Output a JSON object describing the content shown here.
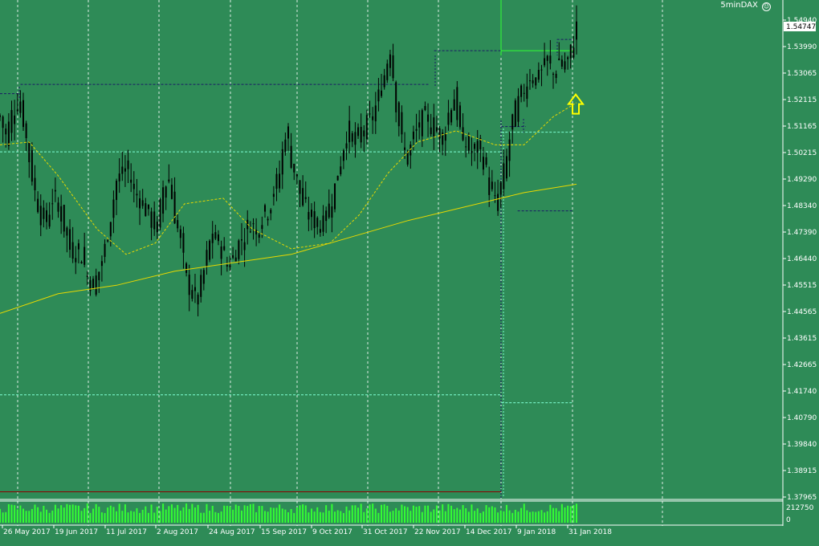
{
  "indicator": {
    "label": "5minDAX",
    "icon": "smiley-icon"
  },
  "chart_data": {
    "type": "candlestick",
    "price_axis": {
      "ticks": [
        "1.54940",
        "1.53990",
        "1.53065",
        "1.52115",
        "1.51165",
        "1.50215",
        "1.49290",
        "1.48340",
        "1.47390",
        "1.46440",
        "1.45515",
        "1.44565",
        "1.43615",
        "1.42665",
        "1.41740",
        "1.40790",
        "1.39840",
        "1.38915",
        "1.37965"
      ],
      "current_price": "1.54747",
      "range": [
        1.37965,
        1.5494
      ]
    },
    "volume_axis": {
      "ticks": [
        "212750",
        "0"
      ]
    },
    "time_axis": {
      "ticks": [
        "26 May 2017",
        "19 Jun 2017",
        "11 Jul 2017",
        "2 Aug 2017",
        "24 Aug 2017",
        "15 Sep 2017",
        "9 Oct 2017",
        "31 Oct 2017",
        "22 Nov 2017",
        "14 Dec 2017",
        "9 Jan 2018",
        "31 Jan 2018"
      ]
    },
    "series": [
      {
        "name": "",
        "kind": "close_path",
        "points": [
          [
            0,
            1.515
          ],
          [
            6,
            1.508
          ],
          [
            12,
            1.516
          ],
          [
            18,
            1.52
          ],
          [
            24,
            1.514
          ],
          [
            30,
            1.5
          ],
          [
            36,
            1.488
          ],
          [
            42,
            1.48
          ],
          [
            48,
            1.478
          ],
          [
            54,
            1.486
          ],
          [
            60,
            1.484
          ],
          [
            66,
            1.476
          ],
          [
            72,
            1.468
          ],
          [
            78,
            1.467
          ],
          [
            84,
            1.466
          ],
          [
            90,
            1.458
          ],
          [
            96,
            1.455
          ],
          [
            102,
            1.46
          ],
          [
            108,
            1.468
          ],
          [
            114,
            1.48
          ],
          [
            120,
            1.492
          ],
          [
            126,
            1.495
          ],
          [
            132,
            1.496
          ],
          [
            138,
            1.488
          ],
          [
            144,
            1.486
          ],
          [
            150,
            1.482
          ],
          [
            156,
            1.478
          ],
          [
            162,
            1.475
          ],
          [
            168,
            1.49
          ],
          [
            174,
            1.493
          ],
          [
            180,
            1.48
          ],
          [
            186,
            1.47
          ],
          [
            192,
            1.457
          ],
          [
            198,
            1.452
          ],
          [
            204,
            1.45
          ],
          [
            210,
            1.46
          ],
          [
            216,
            1.47
          ],
          [
            222,
            1.472
          ],
          [
            228,
            1.468
          ],
          [
            234,
            1.462
          ],
          [
            240,
            1.465
          ],
          [
            246,
            1.47
          ],
          [
            252,
            1.473
          ],
          [
            258,
            1.478
          ],
          [
            264,
            1.474
          ],
          [
            270,
            1.48
          ],
          [
            276,
            1.482
          ],
          [
            282,
            1.488
          ],
          [
            288,
            1.495
          ],
          [
            294,
            1.51
          ],
          [
            300,
            1.5
          ],
          [
            306,
            1.492
          ],
          [
            312,
            1.484
          ],
          [
            318,
            1.48
          ],
          [
            324,
            1.478
          ],
          [
            330,
            1.476
          ],
          [
            336,
            1.48
          ],
          [
            342,
            1.486
          ],
          [
            348,
            1.494
          ],
          [
            354,
            1.505
          ],
          [
            360,
            1.51
          ],
          [
            366,
            1.505
          ],
          [
            372,
            1.51
          ],
          [
            378,
            1.512
          ],
          [
            384,
            1.515
          ],
          [
            390,
            1.522
          ],
          [
            396,
            1.53
          ],
          [
            402,
            1.54
          ],
          [
            408,
            1.52
          ],
          [
            414,
            1.506
          ],
          [
            420,
            1.5
          ],
          [
            426,
            1.508
          ],
          [
            432,
            1.512
          ],
          [
            438,
            1.515
          ],
          [
            444,
            1.512
          ],
          [
            450,
            1.51
          ],
          [
            456,
            1.508
          ],
          [
            462,
            1.516
          ],
          [
            468,
            1.522
          ],
          [
            474,
            1.51
          ],
          [
            480,
            1.505
          ],
          [
            486,
            1.502
          ],
          [
            492,
            1.504
          ],
          [
            498,
            1.5
          ],
          [
            504,
            1.49
          ],
          [
            510,
            1.484
          ],
          [
            516,
            1.49
          ],
          [
            522,
            1.5
          ],
          [
            528,
            1.514
          ],
          [
            534,
            1.52
          ],
          [
            540,
            1.525
          ],
          [
            546,
            1.53
          ],
          [
            552,
            1.528
          ],
          [
            558,
            1.532
          ],
          [
            564,
            1.535
          ],
          [
            570,
            1.53
          ],
          [
            576,
            1.535
          ],
          [
            582,
            1.532
          ],
          [
            588,
            1.538
          ],
          [
            594,
            1.547
          ]
        ],
        "color": "#000000"
      },
      {
        "name": "",
        "kind": "ma_fast",
        "points": [
          [
            0,
            1.505
          ],
          [
            30,
            1.506
          ],
          [
            60,
            1.494
          ],
          [
            100,
            1.475
          ],
          [
            130,
            1.466
          ],
          [
            160,
            1.47
          ],
          [
            190,
            1.484
          ],
          [
            230,
            1.486
          ],
          [
            260,
            1.475
          ],
          [
            300,
            1.468
          ],
          [
            340,
            1.47
          ],
          [
            370,
            1.48
          ],
          [
            400,
            1.495
          ],
          [
            430,
            1.506
          ],
          [
            470,
            1.51
          ],
          [
            510,
            1.505
          ],
          [
            540,
            1.505
          ],
          [
            570,
            1.515
          ],
          [
            594,
            1.52
          ]
        ],
        "color": "#e8d800"
      },
      {
        "name": "",
        "kind": "ma_slow",
        "points": [
          [
            0,
            1.445
          ],
          [
            60,
            1.452
          ],
          [
            120,
            1.455
          ],
          [
            180,
            1.46
          ],
          [
            240,
            1.463
          ],
          [
            300,
            1.466
          ],
          [
            360,
            1.472
          ],
          [
            420,
            1.478
          ],
          [
            480,
            1.483
          ],
          [
            540,
            1.488
          ],
          [
            594,
            1.491
          ]
        ],
        "color": "#e8d800"
      }
    ],
    "levels": [
      {
        "kind": "dark-dashed",
        "price": 1.5232,
        "from": 0,
        "to": 0.025
      },
      {
        "kind": "dark-dashed",
        "price": 1.5265,
        "from": 0.025,
        "to": 0.525
      },
      {
        "kind": "dark-dashed",
        "price": 1.5385,
        "from": 0.53,
        "to": 0.612
      },
      {
        "kind": "dark-dashed",
        "price": 1.5115,
        "from": 0.612,
        "to": 0.642
      },
      {
        "kind": "dark-dashed",
        "price": 1.4815,
        "from": 0.632,
        "to": 0.7
      },
      {
        "kind": "dark-dashed",
        "price": 1.5425,
        "from": 0.68,
        "to": 0.7
      },
      {
        "kind": "cyan-dashed",
        "price": 1.5025,
        "from": 0,
        "to": 0.612
      },
      {
        "kind": "cyan-dashed",
        "price": 1.5095,
        "from": 0.612,
        "to": 0.7
      },
      {
        "kind": "cyan-dashed",
        "price": 1.416,
        "from": 0,
        "to": 0.612
      },
      {
        "kind": "cyan-dashed",
        "price": 1.4132,
        "from": 0.612,
        "to": 0.7
      },
      {
        "kind": "green-solid",
        "price": 1.5385,
        "from": 0.612,
        "to": 0.7
      },
      {
        "kind": "red-solid",
        "price": 1.3815,
        "from": 0,
        "to": 0.612
      }
    ],
    "arrow": {
      "direction": "up",
      "color": "#ffff00",
      "price": 1.5195
    },
    "grid": true,
    "legend": ""
  }
}
